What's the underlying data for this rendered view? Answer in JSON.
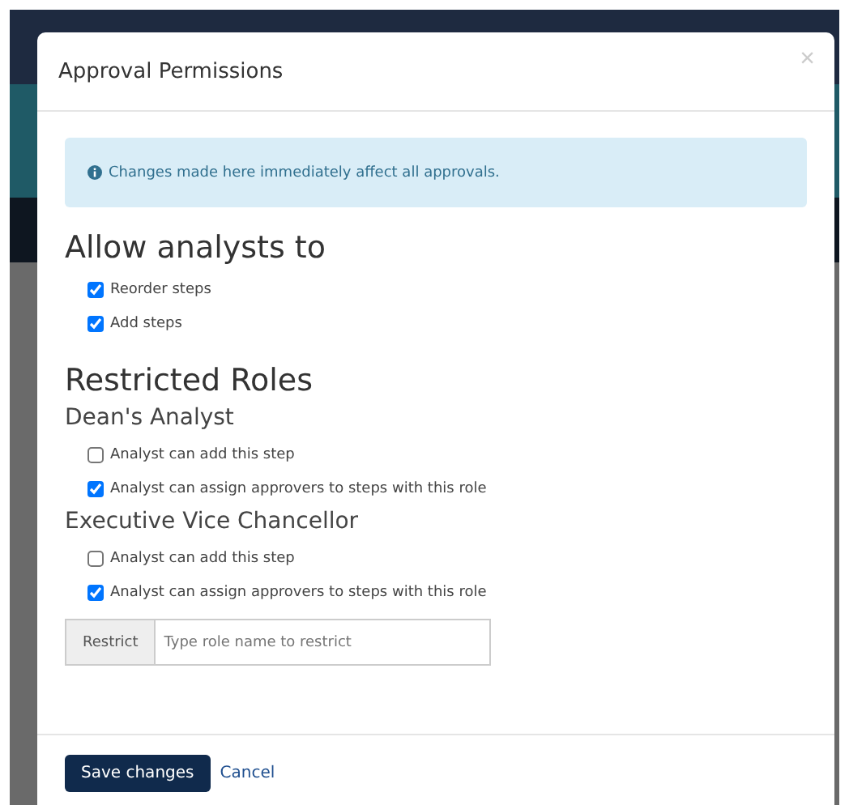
{
  "modal": {
    "title": "Approval Permissions",
    "close": "×"
  },
  "alert": {
    "text": "Changes made here immediately affect all approvals."
  },
  "allow": {
    "heading": "Allow analysts to",
    "options": [
      {
        "label": "Reorder steps",
        "checked": true
      },
      {
        "label": "Add steps",
        "checked": true
      }
    ]
  },
  "restricted": {
    "heading": "Restricted Roles",
    "roles": [
      {
        "name": "Dean's Analyst",
        "options": [
          {
            "label": "Analyst can add this step",
            "checked": false
          },
          {
            "label": "Analyst can assign approvers to steps with this role",
            "checked": true
          }
        ]
      },
      {
        "name": "Executive Vice Chancellor",
        "options": [
          {
            "label": "Analyst can add this step",
            "checked": false
          },
          {
            "label": "Analyst can assign approvers to steps with this role",
            "checked": true
          }
        ]
      }
    ],
    "restrict": {
      "addon": "Restrict",
      "placeholder": "Type role name to restrict"
    }
  },
  "footer": {
    "save": "Save changes",
    "cancel": "Cancel"
  }
}
